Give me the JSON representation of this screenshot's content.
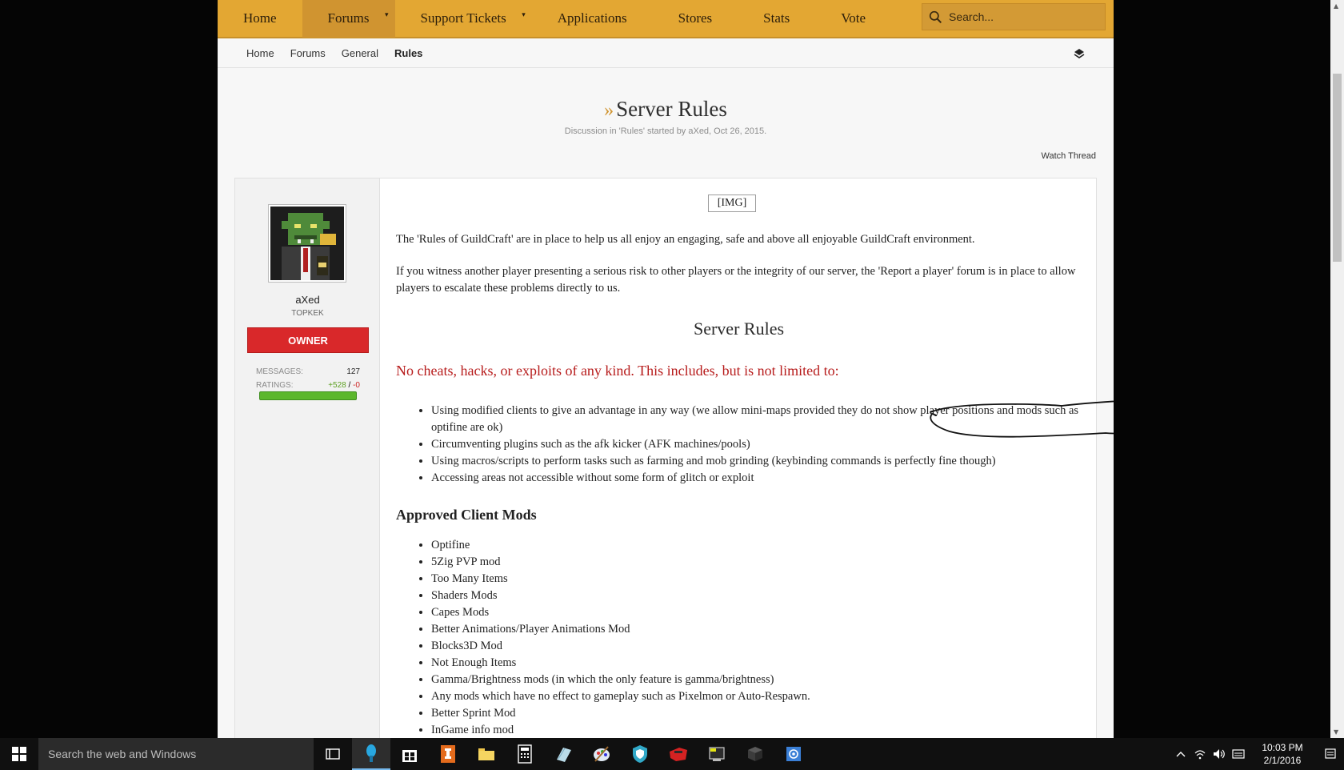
{
  "nav": {
    "tabs": [
      {
        "label": "Home"
      },
      {
        "label": "Forums",
        "caret": "▾"
      },
      {
        "label": "Support Tickets",
        "caret": "▾"
      },
      {
        "label": "Applications"
      },
      {
        "label": "Stores"
      },
      {
        "label": "Stats"
      },
      {
        "label": "Vote"
      }
    ],
    "search_placeholder": "Search..."
  },
  "breadcrumb": [
    "Home",
    "Forums",
    "General",
    "Rules"
  ],
  "thread": {
    "raquo": "»",
    "title": "Server Rules",
    "meta": "Discussion in 'Rules' started by aXed, Oct 26, 2015.",
    "watch": "Watch Thread"
  },
  "user": {
    "name": "aXed",
    "title": "TOPKEK",
    "badge": "OWNER",
    "messages_label": "MESSAGES:",
    "messages": "127",
    "ratings_label": "RATINGS:",
    "ratings_pos": "+528",
    "ratings_sep": " / ",
    "ratings_neg": "-0"
  },
  "post": {
    "img_alt": "[IMG]",
    "intro": "The 'Rules of GuildCraft' are in place to help us all enjoy an engaging, safe and above all enjoyable GuildCraft environment.",
    "report": "If you witness another player presenting a serious risk to other players or the integrity of our server, the 'Report a player' forum is in place to allow players to escalate these problems directly to us.",
    "rules_heading": "Server Rules",
    "cheats_heading": "No cheats, hacks, or exploits of any kind. This includes, but is not limited to:",
    "rules": [
      "Using modified clients to give an advantage in any way (we allow mini-maps provided they do not show player positions and mods such as optifine are ok)",
      "Circumventing plugins such as the afk kicker (AFK machines/pools)",
      "Using macros/scripts to perform tasks such as farming and mob grinding (keybinding commands is perfectly fine though)",
      "Accessing areas not accessible without some form of glitch or exploit"
    ],
    "approved_heading": "Approved Client Mods",
    "mods": [
      "Optifine",
      "5Zig PVP mod",
      "Too Many Items",
      "Shaders Mods",
      "Capes Mods",
      "Better Animations/Player Animations Mod",
      "Blocks3D Mod",
      "Not Enough Items",
      "Gamma/Brightness mods (in which the only feature is gamma/brightness)",
      "Any mods which have no effect to gameplay such as Pixelmon or Auto-Respawn.",
      "Better Sprint Mod",
      "InGame info mod"
    ]
  },
  "taskbar": {
    "search_text": "Search the web and Windows",
    "time": "10:03 PM",
    "date": "2/1/2016"
  },
  "colors": {
    "nav_bg": "#e3a733",
    "owner_badge": "#d9282a",
    "cheats_heading": "#b71c1c",
    "rating_bar": "#5cb72d"
  }
}
